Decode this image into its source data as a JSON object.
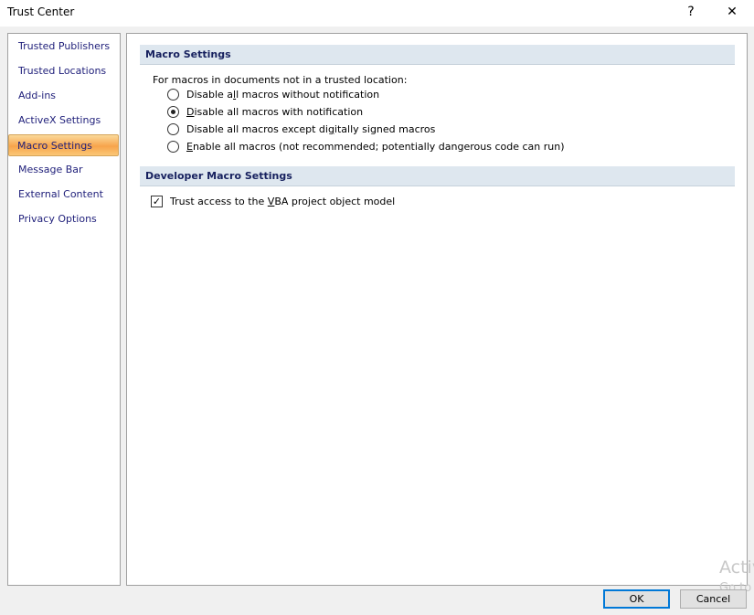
{
  "window": {
    "title": "Trust Center",
    "help_label": "?",
    "close_label": "✕"
  },
  "sidebar": {
    "items": [
      {
        "label": "Trusted Publishers",
        "selected": false
      },
      {
        "label": "Trusted Locations",
        "selected": false
      },
      {
        "label": "Add-ins",
        "selected": false
      },
      {
        "label": "ActiveX Settings",
        "selected": false
      },
      {
        "label": "Macro Settings",
        "selected": true
      },
      {
        "label": "Message Bar",
        "selected": false
      },
      {
        "label": "External Content",
        "selected": false
      },
      {
        "label": "Privacy Options",
        "selected": false
      }
    ]
  },
  "macro": {
    "header": "Macro Settings",
    "intro": "For macros in documents not in a trusted location:",
    "options": [
      {
        "pre": "Disable a",
        "key": "l",
        "post": "l macros without notification",
        "checked": false
      },
      {
        "pre": "",
        "key": "D",
        "post": "isable all macros with notification",
        "checked": true
      },
      {
        "pre": "Disable all macros except di",
        "key": "g",
        "post": "itally signed macros",
        "checked": false
      },
      {
        "pre": "",
        "key": "E",
        "post": "nable all macros (not recommended; potentially dangerous code can run)",
        "checked": false
      }
    ]
  },
  "developer": {
    "header": "Developer Macro Settings",
    "vba": {
      "pre": "Trust access to the ",
      "key": "V",
      "post": "BA project object model",
      "checked": true
    }
  },
  "footer": {
    "ok_label": "OK",
    "cancel_label": "Cancel"
  },
  "watermark": {
    "line1": "Activ",
    "line2": "Go to"
  }
}
